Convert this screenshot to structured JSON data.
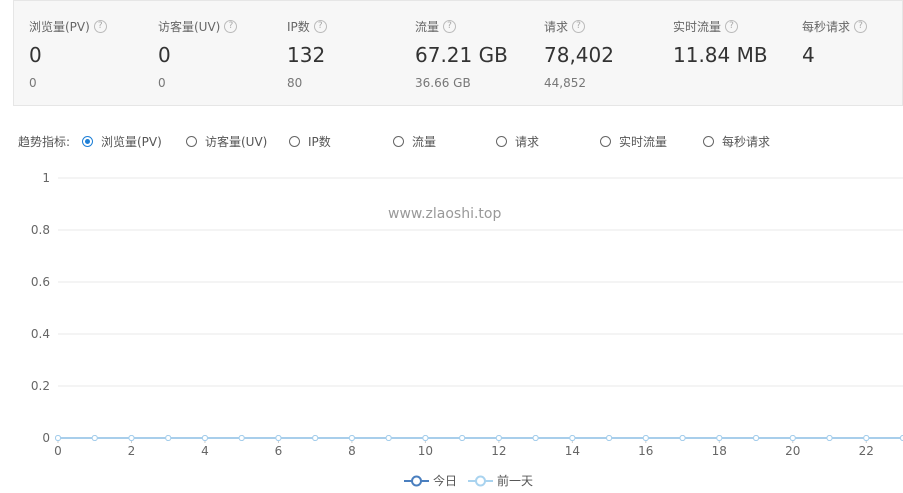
{
  "stats": [
    {
      "label": "浏览量(PV)",
      "value": "0",
      "sub": "0"
    },
    {
      "label": "访客量(UV)",
      "value": "0",
      "sub": "0"
    },
    {
      "label": "IP数",
      "value": "132",
      "sub": "80"
    },
    {
      "label": "流量",
      "value": "67.21 GB",
      "sub": "36.66 GB"
    },
    {
      "label": "请求",
      "value": "78,402",
      "sub": "44,852"
    },
    {
      "label": "实时流量",
      "value": "11.84 MB",
      "sub": ""
    },
    {
      "label": "每秒请求",
      "value": "4",
      "sub": ""
    }
  ],
  "help_icon_glyph": "?",
  "trend": {
    "title": "趋势指标:",
    "options": [
      "浏览量(PV)",
      "访客量(UV)",
      "IP数",
      "流量",
      "请求",
      "实时流量",
      "每秒请求"
    ],
    "selected": "浏览量(PV)"
  },
  "watermark": "www.zlaoshi.top",
  "chart_data": {
    "type": "line",
    "x": [
      0,
      1,
      2,
      3,
      4,
      5,
      6,
      7,
      8,
      9,
      10,
      11,
      12,
      13,
      14,
      15,
      16,
      17,
      18,
      19,
      20,
      21,
      22,
      23
    ],
    "xticks": [
      0,
      2,
      4,
      6,
      8,
      10,
      12,
      14,
      16,
      18,
      20,
      22
    ],
    "ylim": [
      0,
      1
    ],
    "yticks": [
      0,
      0.2,
      0.4,
      0.6,
      0.8,
      1
    ],
    "grid": true,
    "legend_position": "bottom-center",
    "series": [
      {
        "name": "今日",
        "color": "#4a7fbf",
        "values": [
          0,
          0,
          0,
          0,
          0,
          0,
          0,
          0,
          0,
          0,
          0,
          0,
          0,
          0,
          0,
          0,
          0,
          0,
          0,
          0,
          0,
          0,
          0,
          0
        ]
      },
      {
        "name": "前一天",
        "color": "#a9d3ef",
        "values": [
          0,
          0,
          0,
          0,
          0,
          0,
          0,
          0,
          0,
          0,
          0,
          0,
          0,
          0,
          0,
          0,
          0,
          0,
          0,
          0,
          0,
          0,
          0,
          0
        ]
      }
    ]
  }
}
